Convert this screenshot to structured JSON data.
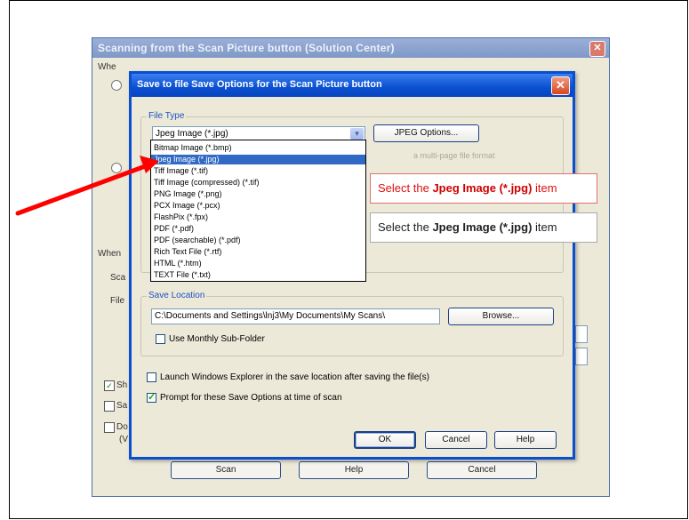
{
  "back_dialog": {
    "title": "Scanning from the Scan Picture button (Solution Center)",
    "close_glyph": "✕",
    "fragments": {
      "when_top": "Whe",
      "when_mid": "When",
      "scan_label": "Sca",
      "file_label": "File",
      "check1_label": "Sh",
      "check2_label": "Sa",
      "check3_label": "Do",
      "check3_sub": "(V"
    },
    "buttons": {
      "scan": "Scan",
      "help": "Help",
      "cancel": "Cancel"
    }
  },
  "dialog": {
    "title": "Save to file Save Options for the Scan Picture button",
    "close_glyph": "✕",
    "file_type": {
      "group_label": "File Type",
      "selected_value": "Jpeg Image (*.jpg)",
      "dropdown_arrow": "▾",
      "options_button": "JPEG Options...",
      "hint_text": "a multi-page file format"
    },
    "dropdown_items": [
      "Bitmap Image (*.bmp)",
      "Jpeg Image (*.jpg)",
      "Tiff Image (*.tif)",
      "Tiff Image (compressed) (*.tif)",
      "PNG Image (*.png)",
      "PCX Image (*.pcx)",
      "FlashPix (*.fpx)",
      "PDF (*.pdf)",
      "PDF (searchable) (*.pdf)",
      "Rich Text File (*.rtf)",
      "HTML (*.htm)",
      "TEXT File (*.txt)"
    ],
    "selected_index": 1,
    "save_location": {
      "group_label": "Save Location",
      "path": "C:\\Documents and Settings\\lnj3\\My Documents\\My Scans\\",
      "browse_button": "Browse...",
      "monthly_subfolder_label": "Use Monthly Sub-Folder",
      "monthly_subfolder_checked": false
    },
    "launch_explorer_label": "Launch Windows Explorer in the save location after saving the file(s)",
    "launch_explorer_checked": false,
    "prompt_label": "Prompt for these Save Options at time of scan",
    "prompt_checked": true,
    "check_glyph": "✓",
    "buttons": {
      "ok": "OK",
      "cancel": "Cancel",
      "help": "Help"
    }
  },
  "callouts": {
    "red": {
      "prefix": "Select the ",
      "bold": "Jpeg Image (*.jpg)",
      "suffix": " item"
    },
    "gray": {
      "prefix": "Select the ",
      "bold": "Jpeg Image (*.jpg)",
      "suffix": " item"
    }
  },
  "colors": {
    "arrow": "#ff0000",
    "selection": "#316ac5",
    "title_bar": "#0a4fd0",
    "dialog_bg": "#ECE9D8"
  }
}
